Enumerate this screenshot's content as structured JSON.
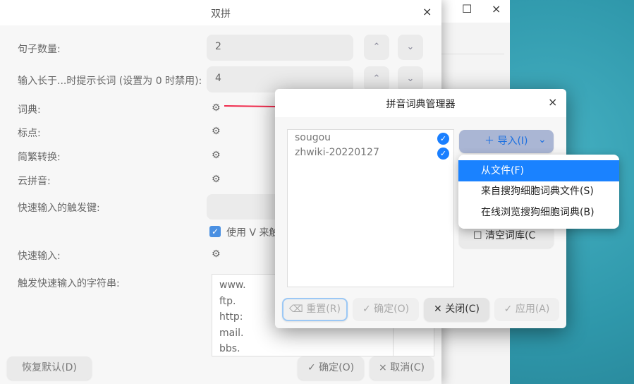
{
  "main_dialog": {
    "title": "双拼",
    "close": "×",
    "rows": [
      {
        "label": "句子数量:",
        "value": "2"
      },
      {
        "label": "输入长于...时提示长词 (设置为 0 时禁用):",
        "value": "4"
      }
    ],
    "gear_rows": [
      "词典:",
      "标点:",
      "简繁转换:",
      "云拼音:"
    ],
    "trigger_key_label": "快速输入的触发键:",
    "checkbox_label": "使用 V 来触",
    "quick_input_label": "快速输入:",
    "trigger_string_label": "触发快速输入的字符串:",
    "trigger_strings": [
      "www.",
      "ftp.",
      "http:",
      "mail.",
      "bbs."
    ],
    "up": "⌃",
    "down": "⌄",
    "gear": "⚙",
    "buttons": {
      "restore": "恢复默认(D)",
      "ok": "✓ 确定(O)",
      "cancel": "× 取消(C)"
    }
  },
  "back_window": {
    "maximize": "☐",
    "close": "×"
  },
  "dict_manager": {
    "title": "拼音词典管理器",
    "close": "×",
    "items": [
      "sougou",
      "zhwiki-20220127"
    ],
    "import_button": "＋  导入(I)",
    "import_chevron": "⌄",
    "clear_button": "☐ 清空词库(C",
    "menu": [
      "从文件(F)",
      "来自搜狗细胞词典文件(S)",
      "在线浏览搜狗细胞词典(B)"
    ],
    "buttons": {
      "reset": "⌫ 重置(R)",
      "ok": "✓ 确定(O)",
      "close": "✕ 关闭(C)",
      "apply": "✓ 应用(A)"
    }
  },
  "colors": {
    "accent": "#1a82ff",
    "annotation": "#f0284a"
  }
}
